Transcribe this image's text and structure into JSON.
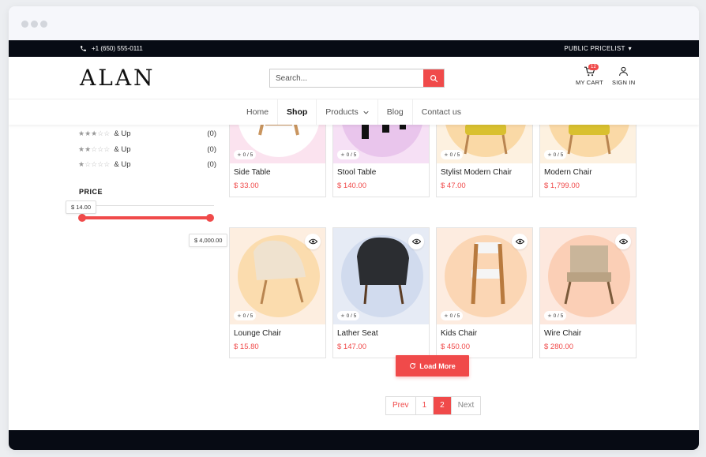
{
  "topbar": {
    "phone": "+1 (650) 555-0111",
    "pricelist": "PUBLIC PRICELIST"
  },
  "header": {
    "logo": "ALAN",
    "search_placeholder": "Search...",
    "cart_label": "MY CART",
    "cart_count": "12",
    "signin_label": "SIGN IN"
  },
  "nav": {
    "home": "Home",
    "shop": "Shop",
    "products": "Products",
    "blog": "Blog",
    "contact": "Contact us"
  },
  "sidebar": {
    "ratings": [
      {
        "stars": 3,
        "label": "& Up",
        "count": "(0)"
      },
      {
        "stars": 2,
        "label": "& Up",
        "count": "(0)"
      },
      {
        "stars": 1,
        "label": "& Up",
        "count": "(0)"
      }
    ],
    "price_title": "PRICE",
    "price_min": "$ 14.00",
    "price_max": "$ 4,000.00"
  },
  "products": [
    {
      "name": "Side Table",
      "price": "$ 33.00",
      "rating": "0 / 5",
      "bg": "#fbe3ef",
      "circle": "#fff",
      "icon": "side-table-image"
    },
    {
      "name": "Stool Table",
      "price": "$ 140.00",
      "rating": "0 / 5",
      "bg": "#f6e0f5",
      "circle": "#e9c5ec",
      "icon": "stool-table-image"
    },
    {
      "name": "Stylist Modern Chair",
      "price": "$ 47.00",
      "rating": "0 / 5",
      "bg": "#fdf1e0",
      "circle": "#fad9a6",
      "icon": "modern-chair-image"
    },
    {
      "name": "Modern Chair",
      "price": "$ 1,799.00",
      "rating": "0 / 5",
      "bg": "#fdf1e0",
      "circle": "#fad9a6",
      "icon": "modern-chair-image"
    },
    {
      "name": "Lounge Chair",
      "price": "$ 15.80",
      "rating": "0 / 5",
      "bg": "#fdeee0",
      "circle": "#fbdcae",
      "icon": "lounge-chair-image"
    },
    {
      "name": "Lather Seat",
      "price": "$ 147.00",
      "rating": "0 / 5",
      "bg": "#e6ebf5",
      "circle": "#d1dbee",
      "icon": "lather-seat-image"
    },
    {
      "name": "Kids Chair",
      "price": "$ 450.00",
      "rating": "0 / 5",
      "bg": "#fdece0",
      "circle": "#fbd6b4",
      "icon": "kids-chair-image"
    },
    {
      "name": "Wire Chair",
      "price": "$ 280.00",
      "rating": "0 / 5",
      "bg": "#fde8de",
      "circle": "#fbcfb6",
      "icon": "wire-chair-image"
    }
  ],
  "load_more": "Load More",
  "pager": {
    "prev": "Prev",
    "p1": "1",
    "p2": "2",
    "next": "Next"
  },
  "colors": {
    "accent": "#f04a4a",
    "dark": "#070b14"
  }
}
